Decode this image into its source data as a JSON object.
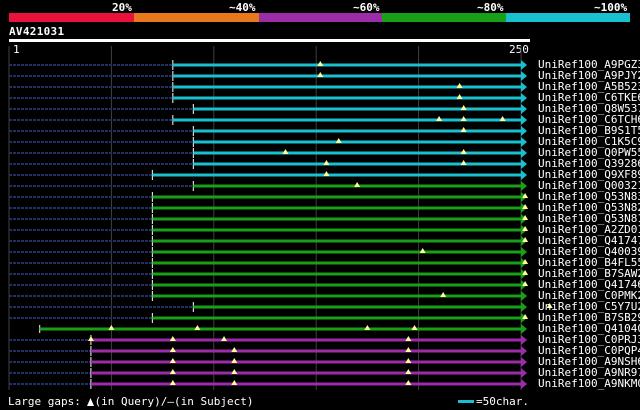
{
  "legend": {
    "segments": [
      {
        "label": "",
        "color": "#e8123c"
      },
      {
        "label": "20%",
        "color": "#e8781c"
      },
      {
        "label": "~40%",
        "color": "#9c2ca8"
      },
      {
        "label": "~60%",
        "color": "#18a018"
      },
      {
        "label": "~80%",
        "color": "#18c0d0"
      },
      {
        "label": "~100%",
        "color": ""
      }
    ]
  },
  "query": {
    "id": "AV421031",
    "start_label": "1",
    "end_label": "250",
    "length": 250
  },
  "hits": [
    {
      "name": "UniRef100_A9PGZ3",
      "color": "#18c0d0",
      "start": 8,
      "dashed_start": true,
      "gaps": [
        15.2
      ]
    },
    {
      "name": "UniRef100_A9PJY2",
      "color": "#18c0d0",
      "start": 8,
      "dashed_start": true,
      "gaps": [
        15.2
      ]
    },
    {
      "name": "UniRef100_A5B523",
      "color": "#18c0d0",
      "start": 8,
      "dashed_start": true,
      "gaps": [
        22.0
      ]
    },
    {
      "name": "UniRef100_C6TKE6",
      "color": "#18c0d0",
      "start": 8,
      "dashed_start": true,
      "gaps": [
        22.0
      ]
    },
    {
      "name": "UniRef100_Q8W537",
      "color": "#18c0d0",
      "start": 9,
      "dashed_start": true,
      "gaps": [
        22.2
      ]
    },
    {
      "name": "UniRef100_C6TCH6",
      "color": "#18c0d0",
      "start": 8,
      "dashed_start": true,
      "gaps": [
        21.0,
        22.2,
        24.1
      ]
    },
    {
      "name": "UniRef100_B9S1T5",
      "color": "#18c0d0",
      "start": 9,
      "dashed_start": true,
      "gaps": [
        22.2
      ]
    },
    {
      "name": "UniRef100_C1K5C9",
      "color": "#18c0d0",
      "start": 9,
      "dashed_start": true,
      "gaps": [
        16.1
      ]
    },
    {
      "name": "UniRef100_Q0PW55",
      "color": "#18c0d0",
      "start": 9,
      "dashed_start": true,
      "gaps": [
        13.5,
        22.2
      ]
    },
    {
      "name": "UniRef100_Q39286",
      "color": "#18c0d0",
      "start": 9,
      "dashed_start": true,
      "gaps": [
        15.5,
        22.2
      ]
    },
    {
      "name": "UniRef100_Q9XF89",
      "color": "#18c0d0",
      "start": 7,
      "dashed_start": true,
      "gaps": [
        15.5
      ]
    },
    {
      "name": "UniRef100_Q00321",
      "color": "#18a018",
      "start": 9,
      "dashed_start": true,
      "gaps": [
        17.0
      ]
    },
    {
      "name": "UniRef100_Q53N83",
      "color": "#18a018",
      "start": 7,
      "dashed_start": true,
      "gaps": [
        25.2
      ]
    },
    {
      "name": "UniRef100_Q53N82",
      "color": "#18a018",
      "start": 7,
      "dashed_start": true,
      "gaps": [
        25.2
      ]
    },
    {
      "name": "UniRef100_Q53N81",
      "color": "#18a018",
      "start": 7,
      "dashed_start": true,
      "gaps": [
        25.2
      ]
    },
    {
      "name": "UniRef100_A2ZD01",
      "color": "#18a018",
      "start": 7,
      "dashed_start": true,
      "gaps": [
        25.2
      ]
    },
    {
      "name": "UniRef100_Q41747",
      "color": "#18a018",
      "start": 7,
      "dashed_start": true,
      "gaps": [
        25.2
      ]
    },
    {
      "name": "UniRef100_Q40039",
      "color": "#18a018",
      "start": 7,
      "dashed_start": true,
      "gaps": [
        20.2
      ]
    },
    {
      "name": "UniRef100_B4FL55",
      "color": "#18a018",
      "start": 7,
      "dashed_start": true,
      "gaps": [
        25.2
      ]
    },
    {
      "name": "UniRef100_B7SAW2",
      "color": "#18a018",
      "start": 7,
      "dashed_start": true,
      "gaps": [
        25.2
      ]
    },
    {
      "name": "UniRef100_Q41746",
      "color": "#18a018",
      "start": 7,
      "dashed_start": true,
      "gaps": [
        25.2
      ]
    },
    {
      "name": "UniRef100_C0PMK2",
      "color": "#18a018",
      "start": 7,
      "dashed_start": true,
      "gaps": [
        21.2
      ]
    },
    {
      "name": "UniRef100_C5Y7U2",
      "color": "#18a018",
      "start": 9,
      "dashed_start": true,
      "gaps": [
        26.4
      ]
    },
    {
      "name": "UniRef100_B7SB29",
      "color": "#18a018",
      "start": 7,
      "dashed_start": true,
      "gaps": [
        25.2
      ]
    },
    {
      "name": "UniRef100_Q41040",
      "color": "#18a018",
      "start": 1.5,
      "dashed_start": false,
      "gaps": [
        5.0,
        9.2,
        17.5,
        19.8
      ]
    },
    {
      "name": "UniRef100_C0PRJ3",
      "color": "#9c2ca8",
      "start": 4,
      "dashed_start": true,
      "gaps": [
        4.0,
        8.0,
        10.5,
        19.5
      ]
    },
    {
      "name": "UniRef100_C0PQP4",
      "color": "#9c2ca8",
      "start": 4,
      "dashed_start": true,
      "gaps": [
        8.0,
        11.0,
        19.5
      ]
    },
    {
      "name": "UniRef100_A9NSH6",
      "color": "#9c2ca8",
      "start": 4,
      "dashed_start": true,
      "gaps": [
        8.0,
        11.0,
        19.5
      ]
    },
    {
      "name": "UniRef100_A9NR97",
      "color": "#9c2ca8",
      "start": 4,
      "dashed_start": true,
      "gaps": [
        8.0,
        11.0,
        19.5
      ]
    },
    {
      "name": "UniRef100_A9NKM0",
      "color": "#9c2ca8",
      "start": 4,
      "dashed_start": true,
      "gaps": [
        8.0,
        11.0,
        19.5
      ]
    }
  ],
  "footer": {
    "large_gaps": "Large gaps:",
    "in_query": "(in Query)/",
    "dash": "–",
    "in_subject": "(in Subject)",
    "scale_key": "=50char."
  },
  "colors": {
    "background": "#000000",
    "grid": "#404040",
    "marker": "#ffff99"
  }
}
